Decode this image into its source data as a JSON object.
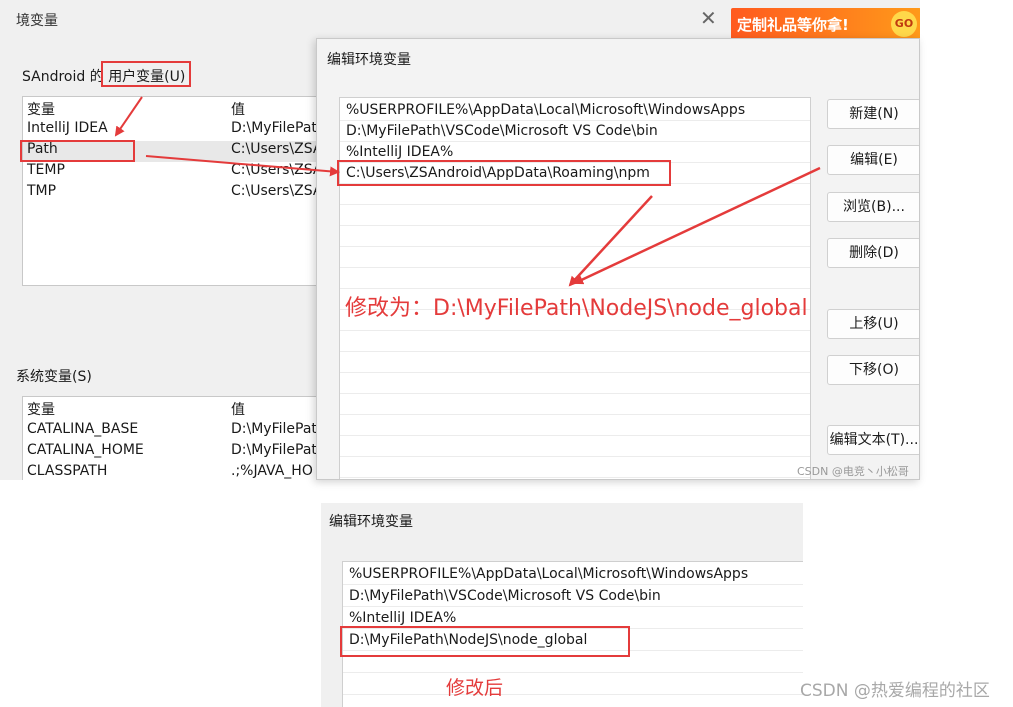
{
  "env_window": {
    "title": "境变量",
    "close_glyph": "✕",
    "ad_text": "定制礼品等你拿!",
    "ad_go": "GO",
    "user_section_prefix": "SAndroid 的",
    "user_section_label": "用户变量(U)",
    "user_table": {
      "headers": [
        "变量",
        "值"
      ],
      "rows": [
        [
          "IntelliJ IDEA",
          "D:\\MyFilePat"
        ],
        [
          "Path",
          "C:\\Users\\ZSA"
        ],
        [
          "TEMP",
          "C:\\Users\\ZSA"
        ],
        [
          "TMP",
          "C:\\Users\\ZSA"
        ]
      ]
    },
    "system_section_label": "系统变量(S)",
    "system_table": {
      "headers": [
        "变量",
        "值"
      ],
      "rows": [
        [
          "CATALINA_BASE",
          "D:\\MyFilePat"
        ],
        [
          "CATALINA_HOME",
          "D:\\MyFilePat"
        ],
        [
          "CLASSPATH",
          ".;%JAVA_HO"
        ]
      ]
    }
  },
  "edit_dialog": {
    "title": "编辑环境变量",
    "items": [
      "%USERPROFILE%\\AppData\\Local\\Microsoft\\WindowsApps",
      "D:\\MyFilePath\\VSCode\\Microsoft VS Code\\bin",
      "%IntelliJ IDEA%",
      "C:\\Users\\ZSAndroid\\AppData\\Roaming\\npm"
    ],
    "buttons": {
      "new": "新建(N)",
      "edit": "编辑(E)",
      "browse": "浏览(B)...",
      "delete": "删除(D)",
      "move_up": "上移(U)",
      "move_down": "下移(O)",
      "edit_text": "编辑文本(T)..."
    },
    "watermark": "CSDN @电竞丶小松哥"
  },
  "edit_dialog_after": {
    "title": "编辑环境变量",
    "items": [
      "%USERPROFILE%\\AppData\\Local\\Microsoft\\WindowsApps",
      "D:\\MyFilePath\\VSCode\\Microsoft VS Code\\bin",
      "%IntelliJ IDEA%",
      "D:\\MyFilePath\\NodeJS\\node_global"
    ]
  },
  "annotations": {
    "modify_to": "修改为：D:\\MyFilePath\\NodeJS\\node_global",
    "after_label": "修改后",
    "accent_color": "#e43b3b"
  },
  "footer_watermark": "CSDN @热爱编程的社区"
}
